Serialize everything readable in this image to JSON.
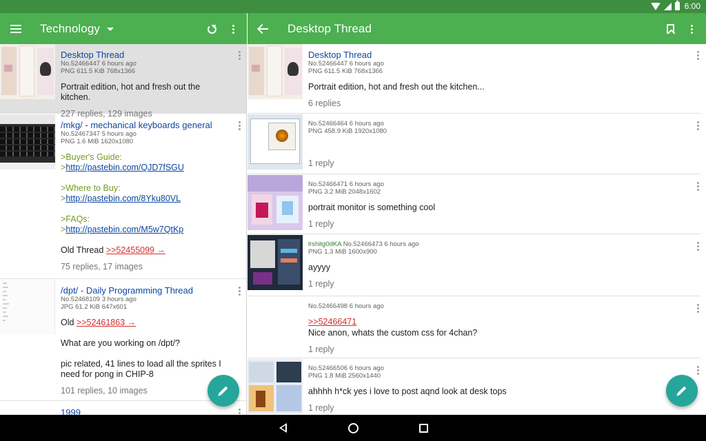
{
  "status_bar": {
    "time": "6:00"
  },
  "board_bar": {
    "title": "Technology"
  },
  "thread_bar": {
    "title": "Desktop Thread"
  },
  "catalog": [
    {
      "subject": "Desktop Thread",
      "meta1": "No.52466447 6 hours ago",
      "meta2": "PNG 611.5 KiB 768x1366",
      "comment": "Portrait edition, hot and fresh out the kitchen.",
      "replies": "227 replies, 129 images"
    },
    {
      "subject": "/mkg/ - mechanical keyboards general",
      "meta1": "No.52467347 5 hours ago",
      "meta2": "PNG 1.6 MiB 1620x1080",
      "g1": ">Buyer's Guide:",
      "gt1": ">",
      "link1": "http://pastebin.com/QJD7fSGU",
      "g2": ">Where to Buy:",
      "gt2": ">",
      "link2": "http://pastebin.com/8Yku80VL",
      "g3": ">FAQs:",
      "gt3": ">",
      "link3": "http://pastebin.com/M5w7QtKp",
      "old_prefix": "Old Thread ",
      "old_quote": ">>52455099 →",
      "replies": "75 replies, 17 images"
    },
    {
      "subject": "/dpt/ - Daily Programming Thread",
      "meta1": "No.52468109 3 hours ago",
      "meta2": "JPG 61.2 KiB 647x601",
      "old_prefix": "Old ",
      "old_quote": ">>52461863 →",
      "line2": "What are you working on /dpt/?",
      "line3": "pic related, 41 lines to load all the sprites I need for pong in CHIP-8",
      "replies": "101 replies, 10 images"
    },
    {
      "subject": "1999"
    }
  ],
  "thread": [
    {
      "subject": "Desktop Thread",
      "meta1": "No.52466447 6 hours ago",
      "meta2": "PNG 611.5 KiB 768x1366",
      "comment": "Portrait edition, hot and fresh out the kitchen...",
      "replies": "6 replies"
    },
    {
      "meta1": "No.52466464 6 hours ago",
      "meta2": "PNG 458.9 KiB 1920x1080",
      "replies": "1 reply"
    },
    {
      "meta1": "No.52466471 6 hours ago",
      "meta2": "PNG 3.2 MiB 2048x1602",
      "comment": "portrait monitor is something cool",
      "replies": "1 reply"
    },
    {
      "uid": "lrshitg0dKA",
      "meta1": " No.52466473 6 hours ago",
      "meta2": "PNG 1.3 MiB 1600x900",
      "comment": "ayyyy",
      "replies": "1 reply"
    },
    {
      "meta1": "No.52466498 6 hours ago",
      "quote": ">>52466471",
      "comment": "Nice anon, whats the custom css for 4chan?",
      "replies": "1 reply"
    },
    {
      "meta1": "No.52466506 6 hours ago",
      "meta2": "PNG 1.8 MiB 2560x1440",
      "comment": "ahhhh h*ck yes i love to post aqnd look at desk tops",
      "replies": "1 reply"
    }
  ],
  "icons": {
    "menu": "menu-icon",
    "dropdown": "chevron-down-icon",
    "refresh": "refresh-icon",
    "overflow": "more-vert-icon",
    "back": "arrow-back-icon",
    "bookmark": "bookmark-icon",
    "compose": "pencil-icon"
  },
  "colors": {
    "primary": "#4caf50",
    "status": "#3d8e3f",
    "fab": "#26a69a",
    "subject": "#0d47a1",
    "greentext": "#789922",
    "quote": "#d32f2f"
  }
}
